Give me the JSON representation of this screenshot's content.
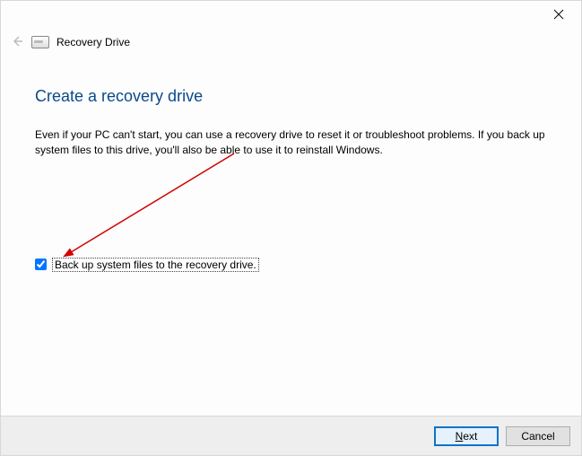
{
  "window": {
    "title": "Recovery Drive"
  },
  "page": {
    "heading": "Create a recovery drive",
    "description": "Even if your PC can't start, you can use a recovery drive to reset it or troubleshoot problems. If you back up system files to this drive, you'll also be able to use it to reinstall Windows."
  },
  "checkbox": {
    "label": "Back up system files to the recovery drive.",
    "checked": true
  },
  "buttons": {
    "next_prefix": "N",
    "next_rest": "ext",
    "cancel": "Cancel"
  }
}
